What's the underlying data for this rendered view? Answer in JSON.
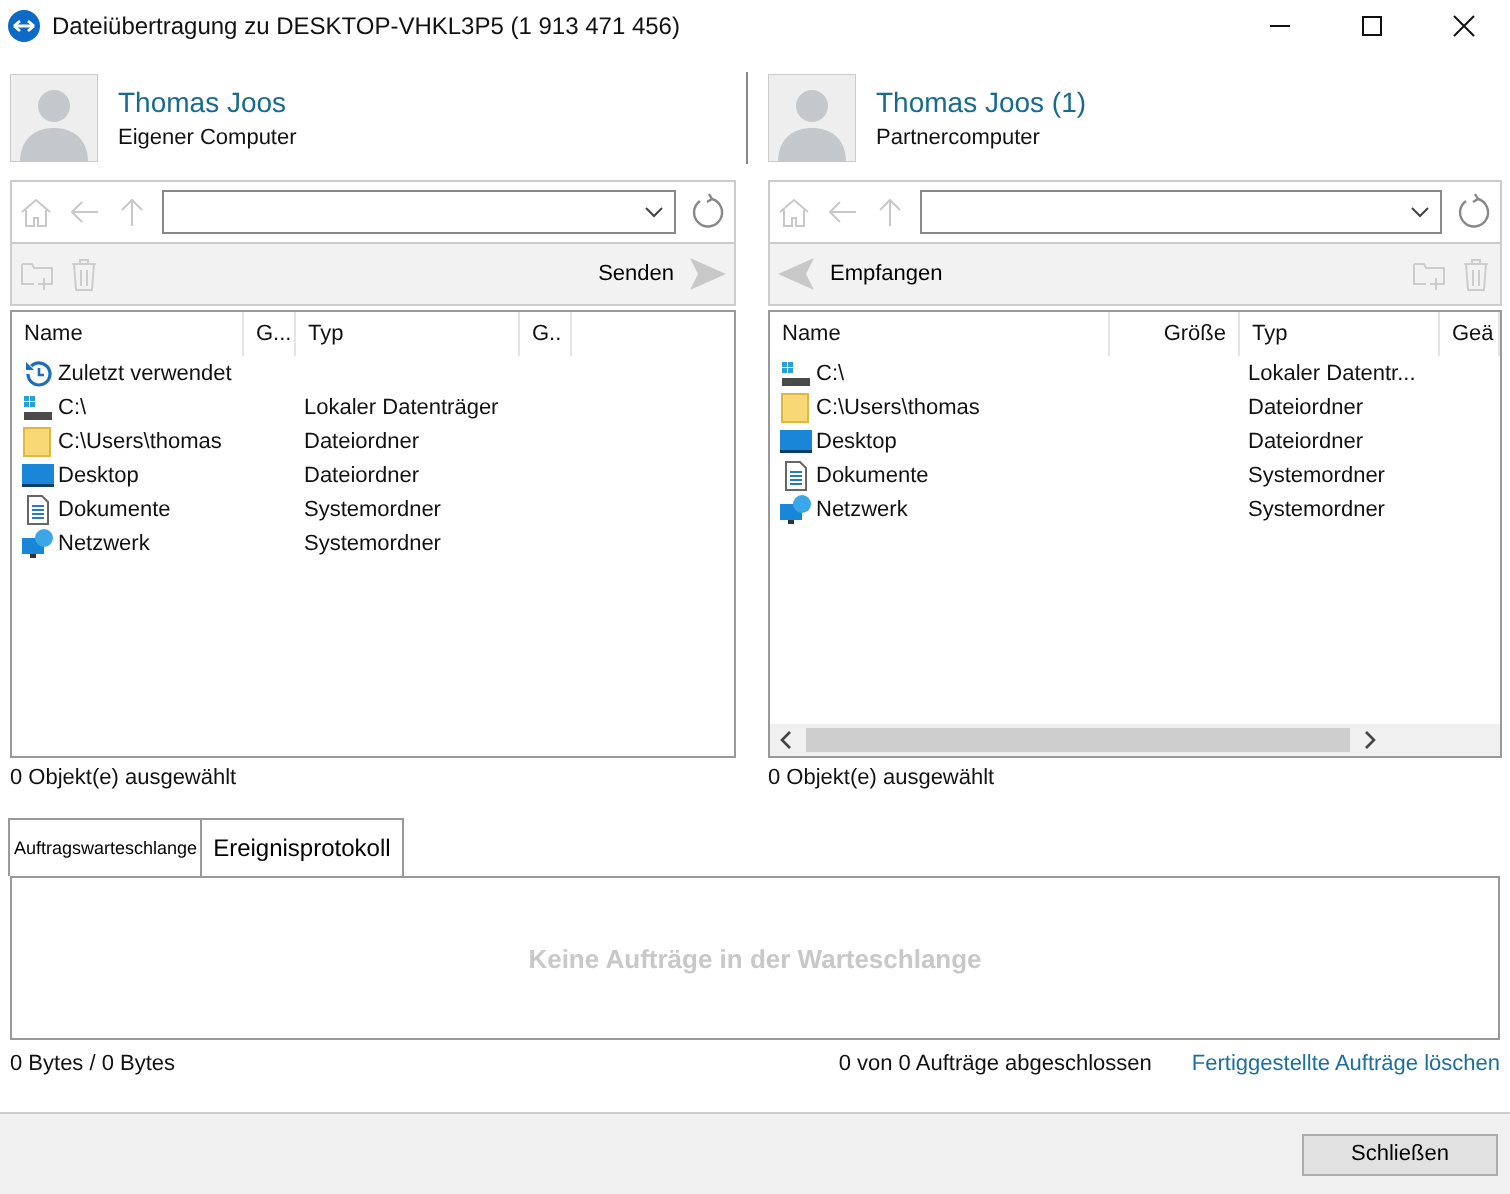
{
  "window": {
    "title": "Dateiübertragung zu DESKTOP-VHKL3P5 (1 913 471 456)"
  },
  "panes": [
    {
      "user": {
        "name": "Thomas Joos",
        "role": "Eigener Computer"
      },
      "action": {
        "kind": "send",
        "label": "Senden"
      },
      "columns": [
        {
          "label": "Name"
        },
        {
          "label": "G..."
        },
        {
          "label": "Typ"
        },
        {
          "label": "G.."
        }
      ],
      "rows": [
        {
          "kind": "recent",
          "name": "Zuletzt verwendet",
          "type": ""
        },
        {
          "kind": "drive",
          "name": "C:\\",
          "type": "Lokaler Datenträger"
        },
        {
          "kind": "folder",
          "name": "C:\\Users\\thomas",
          "type": "Dateiordner"
        },
        {
          "kind": "desktop",
          "name": "Desktop",
          "type": "Dateiordner"
        },
        {
          "kind": "documents",
          "name": "Dokumente",
          "type": "Systemordner"
        },
        {
          "kind": "network",
          "name": "Netzwerk",
          "type": "Systemordner"
        }
      ],
      "hscroll": false,
      "status": "0 Objekt(e) ausgewählt"
    },
    {
      "user": {
        "name": "Thomas Joos (1)",
        "role": "Partnercomputer"
      },
      "action": {
        "kind": "receive",
        "label": "Empfangen"
      },
      "columns": [
        {
          "label": "Name"
        },
        {
          "label": "Größe"
        },
        {
          "label": "Typ"
        },
        {
          "label": "Geä"
        }
      ],
      "rows": [
        {
          "kind": "drive",
          "name": "C:\\",
          "type": "Lokaler Datentr..."
        },
        {
          "kind": "folder",
          "name": "C:\\Users\\thomas",
          "type": "Dateiordner"
        },
        {
          "kind": "desktop",
          "name": "Desktop",
          "type": "Dateiordner"
        },
        {
          "kind": "documents",
          "name": "Dokumente",
          "type": "Systemordner"
        },
        {
          "kind": "network",
          "name": "Netzwerk",
          "type": "Systemordner"
        }
      ],
      "hscroll": true,
      "status": "0 Objekt(e) ausgewählt"
    }
  ],
  "tabs": [
    {
      "label": "Auftragswarteschlange",
      "selected": true
    },
    {
      "label": "Ereignisprotokoll",
      "selected": false
    }
  ],
  "queue": {
    "empty_message": "Keine Aufträge in der Warteschlange"
  },
  "status_bar": {
    "bytes": "0 Bytes / 0 Bytes",
    "progress": "0 von 0 Aufträge abgeschlossen",
    "link": "Fertiggestellte Aufträge löschen"
  },
  "buttons": [
    "Schließen"
  ]
}
